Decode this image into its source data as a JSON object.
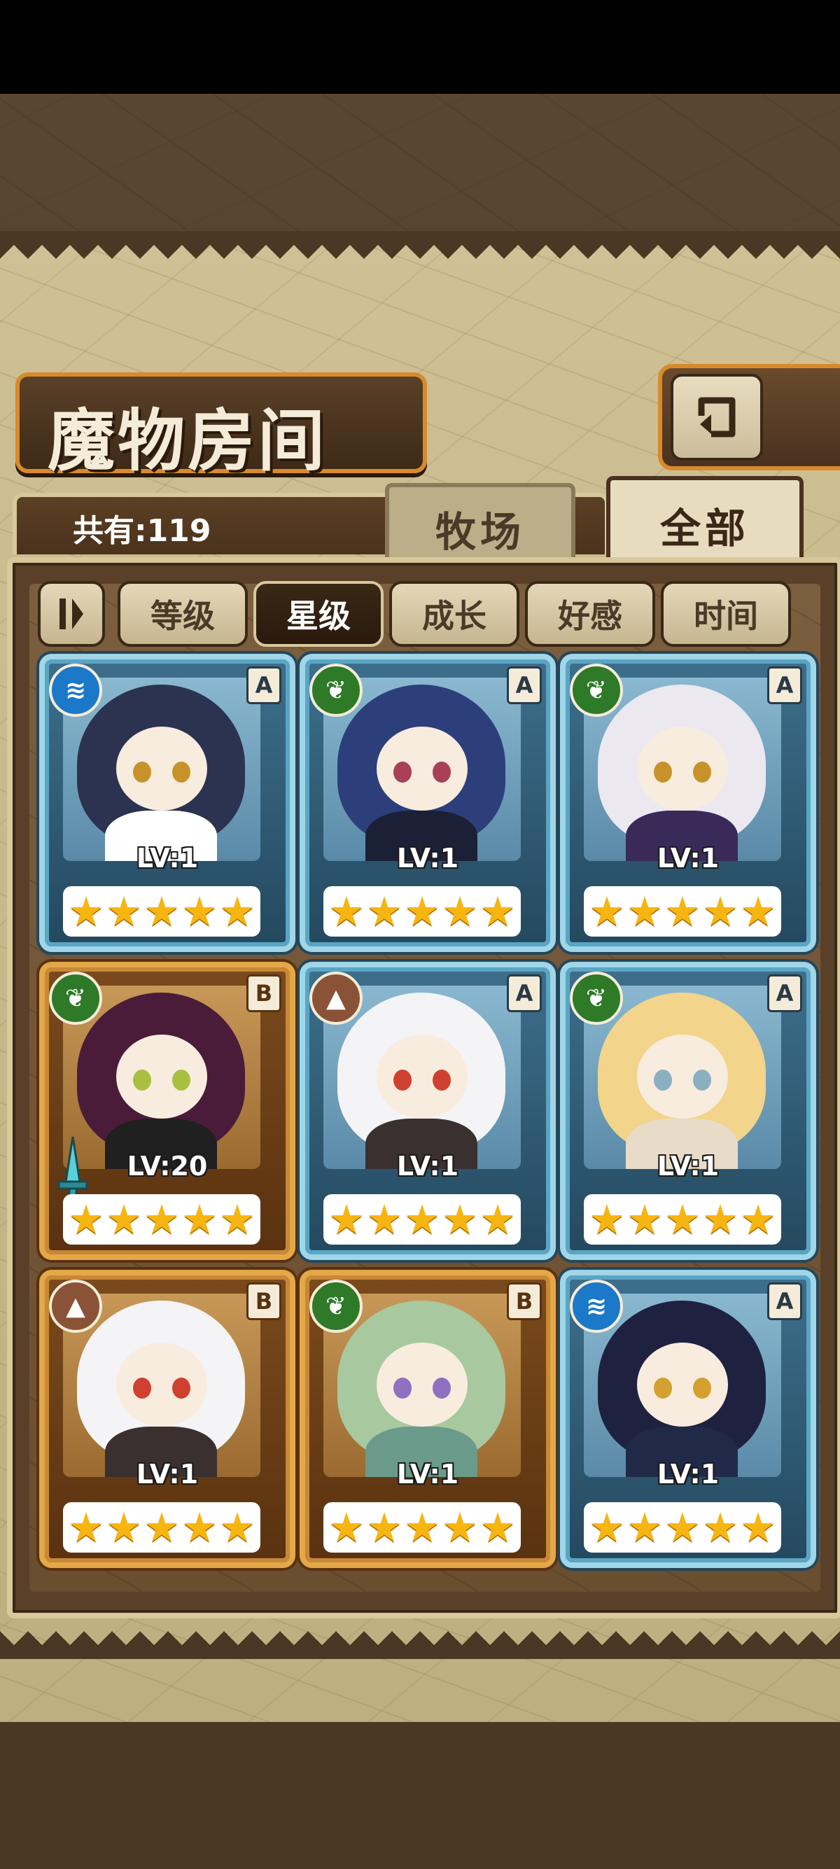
{
  "title": "魔物房间",
  "count": "共有:119",
  "tabs": [
    {
      "label": "牧场"
    },
    {
      "label": "全部"
    }
  ],
  "filters": [
    {
      "label": "等级"
    },
    {
      "label": "星级"
    },
    {
      "label": "成长"
    },
    {
      "label": "好感"
    },
    {
      "label": "时间"
    }
  ],
  "active_filter": "星级",
  "cards": [
    {
      "level": "LV:1",
      "grade": "A",
      "element": "water-icon",
      "stars": 5,
      "hair": "#2c3350",
      "eye": "#c8922a",
      "body": "#ffffff"
    },
    {
      "level": "LV:1",
      "grade": "A",
      "element": "leaf-icon",
      "stars": 5,
      "hair": "#2d3f7a",
      "eye": "#a84058",
      "body": "#1c2036"
    },
    {
      "level": "LV:1",
      "grade": "A",
      "element": "leaf-icon",
      "stars": 5,
      "hair": "#ece8f0",
      "eye": "#c8922a",
      "body": "#3a2a5a"
    },
    {
      "level": "LV:20",
      "grade": "B",
      "element": "leaf-icon",
      "stars": 5,
      "hair": "#4a1c3a",
      "eye": "#a8c040",
      "body": "#202020"
    },
    {
      "level": "LV:1",
      "grade": "A",
      "element": "earth-icon",
      "stars": 5,
      "hair": "#f4f4f6",
      "eye": "#d04030",
      "body": "#3a3030"
    },
    {
      "level": "LV:1",
      "grade": "A",
      "element": "leaf-icon",
      "stars": 5,
      "hair": "#f2d48a",
      "eye": "#8ab0c0",
      "body": "#e8dcc8"
    },
    {
      "level": "LV:1",
      "grade": "B",
      "element": "earth-icon",
      "stars": 5,
      "hair": "#f4f4f6",
      "eye": "#d04030",
      "body": "#3a3030"
    },
    {
      "level": "LV:1",
      "grade": "B",
      "element": "leaf-icon",
      "stars": 5,
      "hair": "#a8c8a0",
      "eye": "#9070c0",
      "body": "#6a9a8a"
    },
    {
      "level": "LV:1",
      "grade": "A",
      "element": "water-icon",
      "stars": 5,
      "hair": "#1e2240",
      "eye": "#d4a030",
      "body": "#202a48"
    }
  ]
}
